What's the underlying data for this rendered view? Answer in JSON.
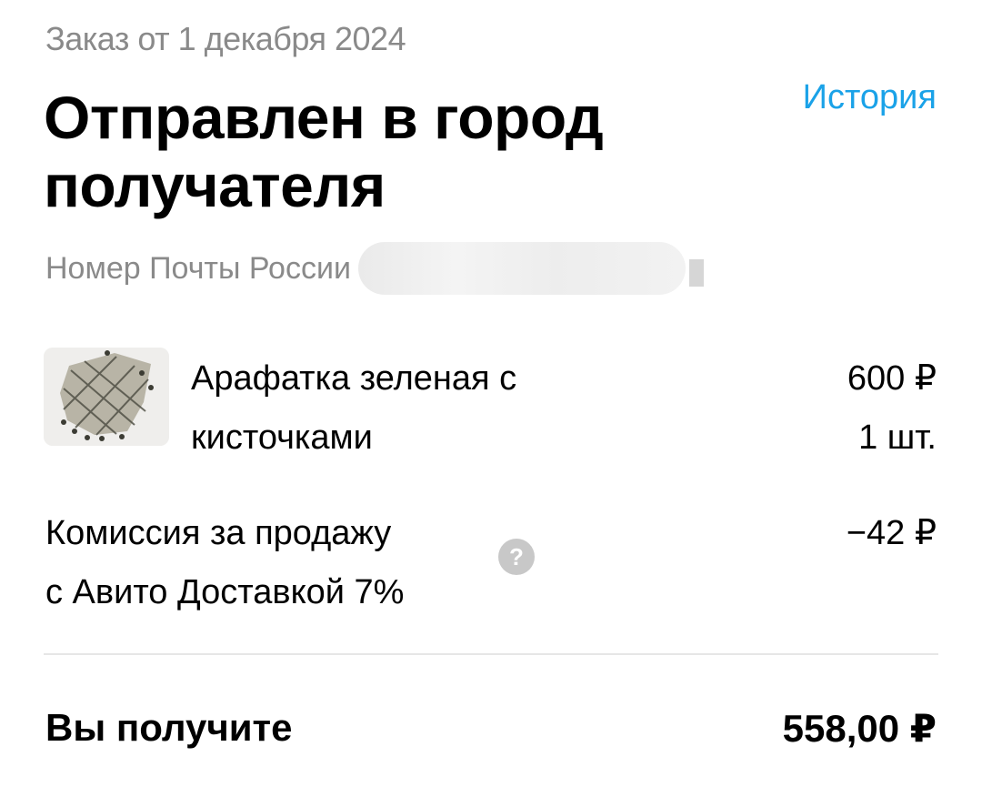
{
  "order": {
    "date_label": "Заказ от 1 декабря 2024",
    "status_title": "Отправлен в город получателя",
    "history_link": "История",
    "tracking_label": "Номер Почты России"
  },
  "item": {
    "name_line1": "Арафатка зеленая с",
    "name_line2": "кисточками",
    "price": "600 ₽",
    "quantity": "1 шт."
  },
  "fee": {
    "label_line1": "Комиссия за продажу",
    "label_line2": "с Авито Доставкой 7%",
    "help_icon": "?",
    "value": "−42 ₽"
  },
  "total": {
    "label": "Вы получите",
    "value": "558,00 ₽"
  },
  "colors": {
    "link": "#1aa2e8",
    "muted": "#8a8a8a",
    "text": "#000000"
  }
}
